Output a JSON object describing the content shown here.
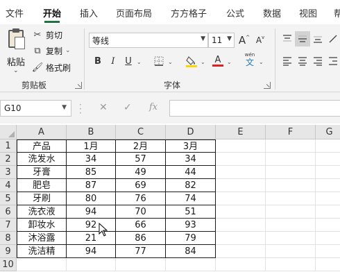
{
  "tabs": [
    "文件",
    "开始",
    "插入",
    "页面布局",
    "方方格子",
    "公式",
    "数据",
    "视图",
    "帮"
  ],
  "active_tab": "开始",
  "ribbon": {
    "paste_label": "粘贴",
    "cut_label": "剪切",
    "copy_label": "复制",
    "format_painter_label": "格式刷",
    "clipboard_group": "剪贴板",
    "font_group": "字体",
    "font_name": "等线",
    "font_size": "11",
    "grow_font": "A",
    "shrink_font": "A",
    "bold": "B",
    "italic": "I",
    "underline": "U",
    "font_color_glyph": "A",
    "highlight_color": "#ffd500",
    "font_color": "#e02020",
    "phonetic_top": "wén",
    "phonetic_bottom": "文"
  },
  "formula_bar": {
    "name_box": "G10",
    "cancel_icon": "✕",
    "enter_icon": "✓",
    "fx_label": "fx",
    "formula": ""
  },
  "sheet": {
    "columns": [
      "A",
      "B",
      "C",
      "D",
      "E",
      "F",
      "G"
    ],
    "rows": [
      "1",
      "2",
      "3",
      "4",
      "5",
      "6",
      "7",
      "8",
      "9",
      "10"
    ],
    "header": [
      "产品",
      "1月",
      "2月",
      "3月"
    ],
    "data": [
      [
        "洗发水",
        "34",
        "57",
        "34"
      ],
      [
        "牙膏",
        "85",
        "49",
        "44"
      ],
      [
        "肥皂",
        "87",
        "69",
        "82"
      ],
      [
        "牙刷",
        "80",
        "76",
        "74"
      ],
      [
        "洗衣液",
        "94",
        "70",
        "51"
      ],
      [
        "卸妆水",
        "92",
        "66",
        "93"
      ],
      [
        "沐浴露",
        "21",
        "86",
        "79"
      ],
      [
        "洗洁精",
        "94",
        "77",
        "84"
      ]
    ]
  }
}
